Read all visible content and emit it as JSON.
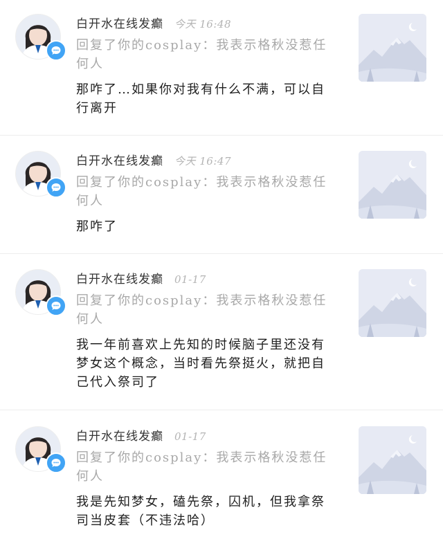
{
  "notifications": [
    {
      "username": "白开水在线发癫",
      "time": "今天 16:48",
      "reply": "回复了你的cosplay：我表示格秋没惹任何人",
      "text": "那咋了…如果你对我有什么不满，可以自行离开",
      "avatar_icon": "user-avatar-photo",
      "badge_icon": "comment-bubble-icon",
      "thumb_icon": "image-placeholder-mountain-icon"
    },
    {
      "username": "白开水在线发癫",
      "time": "今天 16:47",
      "reply": "回复了你的cosplay：我表示格秋没惹任何人",
      "text": "那咋了",
      "avatar_icon": "user-avatar-photo",
      "badge_icon": "comment-bubble-icon",
      "thumb_icon": "image-placeholder-mountain-icon"
    },
    {
      "username": "白开水在线发癫",
      "time": "01-17",
      "reply": "回复了你的cosplay：我表示格秋没惹任何人",
      "text": "我一年前喜欢上先知的时候脑子里还没有梦女这个概念，当时看先祭挺火，就把自己代入祭司了",
      "avatar_icon": "user-avatar-photo",
      "badge_icon": "comment-bubble-icon",
      "thumb_icon": "image-placeholder-mountain-icon"
    },
    {
      "username": "白开水在线发癫",
      "time": "01-17",
      "reply": "回复了你的cosplay：我表示格秋没惹任何人",
      "text": "我是先知梦女，磕先祭，囚机，但我拿祭司当皮套（不违法哈）",
      "avatar_icon": "user-avatar-photo",
      "badge_icon": "comment-bubble-icon",
      "thumb_icon": "image-placeholder-mountain-icon"
    }
  ],
  "colors": {
    "badge": "#41a4f5",
    "meta_text": "#b4b4b4",
    "reply_text": "#a8a8a8",
    "divider": "#ededed"
  }
}
